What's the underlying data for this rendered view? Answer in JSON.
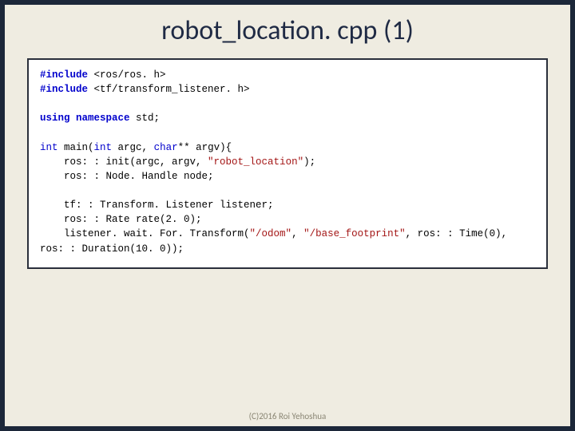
{
  "title": "robot_location. cpp (1)",
  "footer": "(C)2016 Roi Yehoshua",
  "code": {
    "l1a": "#include ",
    "l1b": "<ros/ros. h>",
    "l2a": "#include ",
    "l2b": "<tf/transform_listener. h>",
    "l3": "",
    "l4a": "using ",
    "l4b": "namespace ",
    "l4c": "std;",
    "l5": "",
    "l6a": "int ",
    "l6b": "main(",
    "l6c": "int ",
    "l6d": "argc, ",
    "l6e": "char",
    "l6f": "** argv){",
    "l7a": "    ros: : init(argc, argv, ",
    "l7b": "\"robot_location\"",
    "l7c": ");",
    "l8": "    ros: : Node. Handle node;",
    "l9": "",
    "l10": "    tf: : Transform. Listener listener;",
    "l11": "    ros: : Rate rate(2. 0);",
    "l12a": "    listener. wait. For. Transform(",
    "l12b": "\"/odom\"",
    "l12c": ", ",
    "l12d": "\"/base_footprint\"",
    "l12e": ", ros: : Time(0),",
    "l13": "ros: : Duration(10. 0));"
  }
}
